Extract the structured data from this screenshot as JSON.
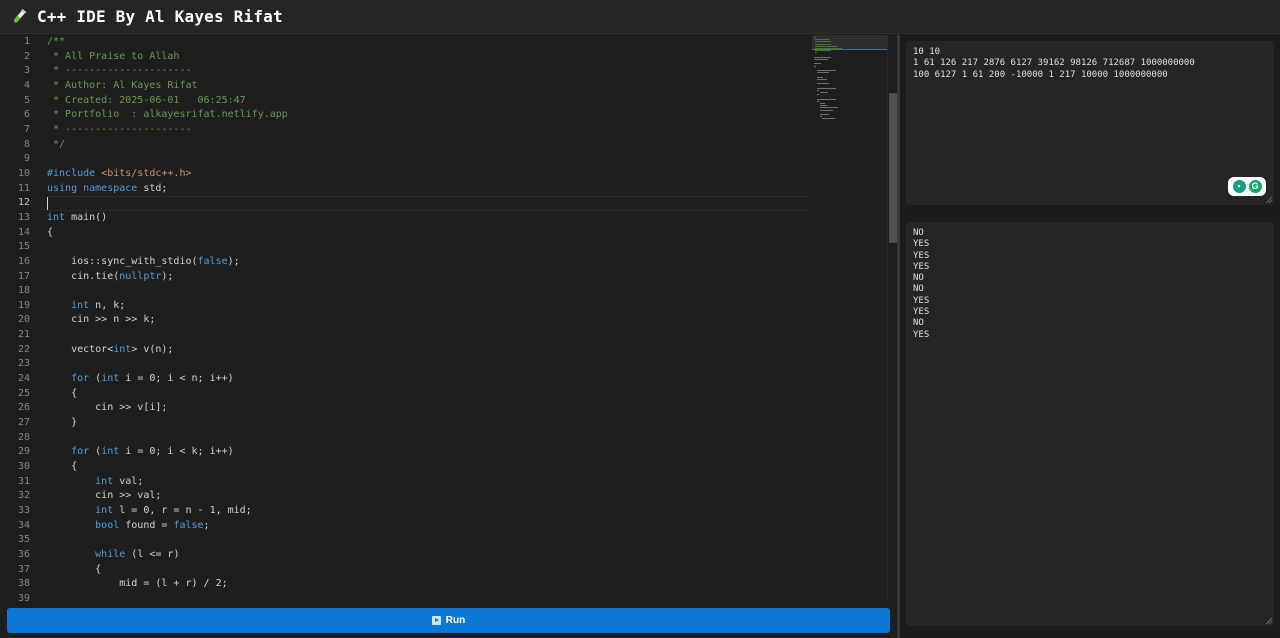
{
  "header": {
    "title": "C++ IDE By Al Kayes Rifat",
    "logo_icon": "test-tube-icon"
  },
  "editor": {
    "current_line": 12,
    "lines": [
      [
        [
          "c-cm",
          "/**"
        ]
      ],
      [
        [
          "c-cm",
          " * All Praise to Allah"
        ]
      ],
      [
        [
          "c-cm",
          " * ---------------------"
        ]
      ],
      [
        [
          "c-cm",
          " * Author: Al Kayes Rifat"
        ]
      ],
      [
        [
          "c-cm",
          " * Created: 2025-06-01   06:25:47"
        ]
      ],
      [
        [
          "c-cm",
          " * Portfolio  : alkayesrifat.netlify.app"
        ]
      ],
      [
        [
          "c-cm",
          " * ---------------------"
        ]
      ],
      [
        [
          "c-cm",
          " */"
        ]
      ],
      [],
      [
        [
          "c-pp",
          "#include "
        ],
        [
          "c-str",
          "<bits/stdc++.h>"
        ]
      ],
      [
        [
          "c-kw",
          "using namespace"
        ],
        [
          "c-tx",
          " std;"
        ]
      ],
      [],
      [
        [
          "c-kw",
          "int"
        ],
        [
          "c-tx",
          " main()"
        ]
      ],
      [
        [
          "c-tx",
          "{"
        ]
      ],
      [],
      [
        [
          "c-tx",
          "    ios::sync_with_stdio("
        ],
        [
          "c-kw",
          "false"
        ],
        [
          "c-tx",
          ");"
        ]
      ],
      [
        [
          "c-tx",
          "    cin.tie("
        ],
        [
          "c-kw",
          "nullptr"
        ],
        [
          "c-tx",
          ");"
        ]
      ],
      [],
      [
        [
          "c-kw",
          "    int"
        ],
        [
          "c-tx",
          " n, k;"
        ]
      ],
      [
        [
          "c-tx",
          "    cin >> n >> k;"
        ]
      ],
      [],
      [
        [
          "c-tx",
          "    vector<"
        ],
        [
          "c-kw",
          "int"
        ],
        [
          "c-tx",
          "> v(n);"
        ]
      ],
      [],
      [
        [
          "c-kw",
          "    for"
        ],
        [
          "c-tx",
          " ("
        ],
        [
          "c-kw",
          "int"
        ],
        [
          "c-tx",
          " i = 0; i < n; i++)"
        ]
      ],
      [
        [
          "c-tx",
          "    {"
        ]
      ],
      [
        [
          "c-tx",
          "        cin >> v[i];"
        ]
      ],
      [
        [
          "c-tx",
          "    }"
        ]
      ],
      [],
      [
        [
          "c-kw",
          "    for"
        ],
        [
          "c-tx",
          " ("
        ],
        [
          "c-kw",
          "int"
        ],
        [
          "c-tx",
          " i = 0; i < k; i++)"
        ]
      ],
      [
        [
          "c-tx",
          "    {"
        ]
      ],
      [
        [
          "c-kw",
          "        int"
        ],
        [
          "c-tx",
          " val;"
        ]
      ],
      [
        [
          "c-tx",
          "        cin >> val;"
        ]
      ],
      [
        [
          "c-kw",
          "        int"
        ],
        [
          "c-tx",
          " l = 0, r = n - 1, mid;"
        ]
      ],
      [
        [
          "c-kw",
          "        bool"
        ],
        [
          "c-tx",
          " found = "
        ],
        [
          "c-kw",
          "false"
        ],
        [
          "c-tx",
          ";"
        ]
      ],
      [],
      [
        [
          "c-kw",
          "        while"
        ],
        [
          "c-tx",
          " (l <= r)"
        ]
      ],
      [
        [
          "c-tx",
          "        {"
        ]
      ],
      [
        [
          "c-tx",
          "            mid = (l + r) / 2;"
        ]
      ],
      []
    ]
  },
  "run_button": {
    "label": "Run",
    "icon": "play-icon"
  },
  "input_panel": {
    "text": "10 10\n1 61 126 217 2876 6127 39162 98126 712687 1000000000\n100 6127 1 61 200 -10000 1 217 10000 1000000000"
  },
  "output_panel": {
    "text": "NO\nYES\nYES\nYES\nNO\nNO\nYES\nYES\nNO\nYES"
  },
  "colors": {
    "run_button": "#0e79d4",
    "comment": "#6a9955",
    "keyword": "#569cd6",
    "string": "#ce9178"
  }
}
